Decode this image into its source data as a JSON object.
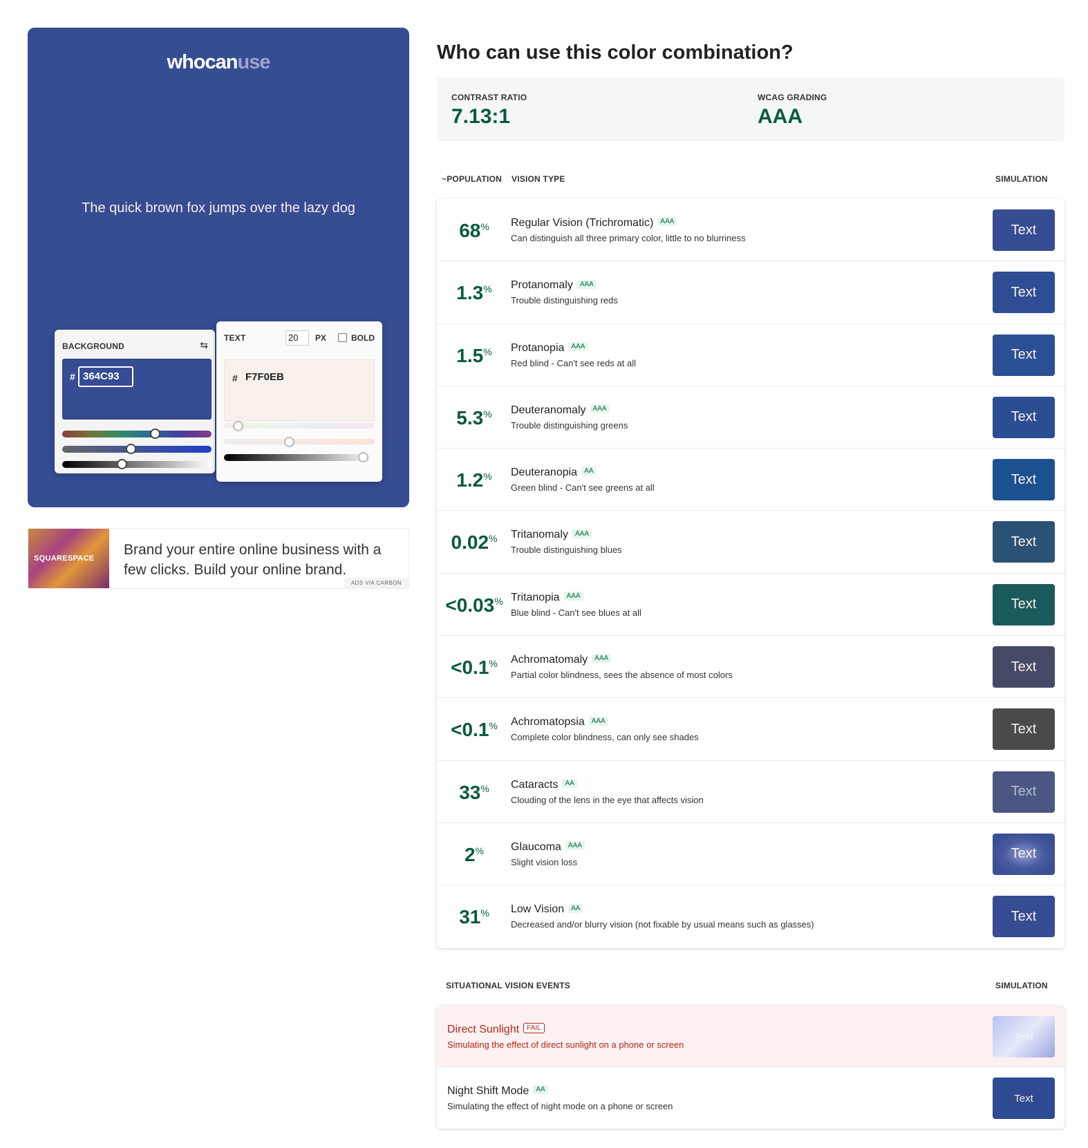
{
  "preview": {
    "logo_a": "whocan",
    "logo_b": "use",
    "sample_text": "The quick brown fox jumps over the lazy dog",
    "background_color": "#364C93",
    "text_color": "#F7F0EB"
  },
  "bg_picker": {
    "label": "BACKGROUND",
    "hash": "#",
    "hex": "364C93",
    "swap_icon": "swap-icon"
  },
  "text_picker": {
    "label": "TEXT",
    "size": "20",
    "unit": "PX",
    "bold_label": "BOLD",
    "hash": "#",
    "hex": "F7F0EB"
  },
  "ad": {
    "brand": "SQUARESPACE",
    "text": "Brand your entire online business with a few clicks. Build your online brand.",
    "via": "ADS VIA CARBON"
  },
  "heading": "Who can use this color combination?",
  "summary": {
    "contrast_label": "CONTRAST RATIO",
    "contrast_value": "7.13:1",
    "wcag_label": "WCAG GRADING",
    "wcag_value": "AAA"
  },
  "table_headers": {
    "population": "~POPULATION",
    "vision_type": "VISION TYPE",
    "simulation": "SIMULATION"
  },
  "vision_rows": [
    {
      "pct": "68",
      "name": "Regular Vision (Trichromatic)",
      "grade": "AAA",
      "desc": "Can distinguish all three primary color, little to no blurriness",
      "sim": "Text",
      "sim_color": "#364C93"
    },
    {
      "pct": "1.3",
      "name": "Protanomaly",
      "grade": "AAA",
      "desc": "Trouble distinguishing reds",
      "sim": "Text",
      "sim_color": "#2f4d94"
    },
    {
      "pct": "1.5",
      "name": "Protanopia",
      "grade": "AAA",
      "desc": "Red blind - Can't see reds at all",
      "sim": "Text",
      "sim_color": "#2b4f95"
    },
    {
      "pct": "5.3",
      "name": "Deuteranomaly",
      "grade": "AAA",
      "desc": "Trouble distinguishing greens",
      "sim": "Text",
      "sim_color": "#2a4e91"
    },
    {
      "pct": "1.2",
      "name": "Deuteranopia",
      "grade": "AA",
      "desc": "Green blind - Can't see greens at all",
      "sim": "Text",
      "sim_color": "#1c518f"
    },
    {
      "pct": "0.02",
      "name": "Tritanomaly",
      "grade": "AAA",
      "desc": "Trouble distinguishing blues",
      "sim": "Text",
      "sim_color": "#2a5275"
    },
    {
      "pct": "<0.03",
      "name": "Tritanopia",
      "grade": "AAA",
      "desc": "Blue blind - Can't see blues at all",
      "sim": "Text",
      "sim_color": "#1a5a5d"
    },
    {
      "pct": "<0.1",
      "name": "Achromatomaly",
      "grade": "AAA",
      "desc": "Partial color blindness, sees the absence of most colors",
      "sim": "Text",
      "sim_color": "#454a66"
    },
    {
      "pct": "<0.1",
      "name": "Achromatopsia",
      "grade": "AAA",
      "desc": "Complete color blindness, can only see shades",
      "sim": "Text",
      "sim_color": "#4a4a4a"
    },
    {
      "pct": "33",
      "name": "Cataracts",
      "grade": "AA",
      "desc": "Clouding of the lens in the eye that affects vision",
      "sim": "Text",
      "sim_color": "#4c5682"
    },
    {
      "pct": "2",
      "name": "Glaucoma",
      "grade": "AAA",
      "desc": "Slight vision loss",
      "sim": "Text",
      "sim_color": "#3b4f95"
    },
    {
      "pct": "31",
      "name": "Low Vision",
      "grade": "AA",
      "desc": "Decreased and/or blurry vision (not fixable by usual means such as glasses)",
      "sim": "Text",
      "sim_color": "#364C93"
    }
  ],
  "situational": {
    "header": "SITUATIONAL VISION EVENTS",
    "simulation": "SIMULATION",
    "rows": [
      {
        "name": "Direct Sunlight",
        "grade": "FAIL",
        "desc": "Simulating the effect of direct sunlight on a phone or screen",
        "sim": "Text"
      },
      {
        "name": "Night Shift Mode",
        "grade": "AA",
        "desc": "Simulating the effect of night mode on a phone or screen",
        "sim": "Text"
      }
    ]
  }
}
